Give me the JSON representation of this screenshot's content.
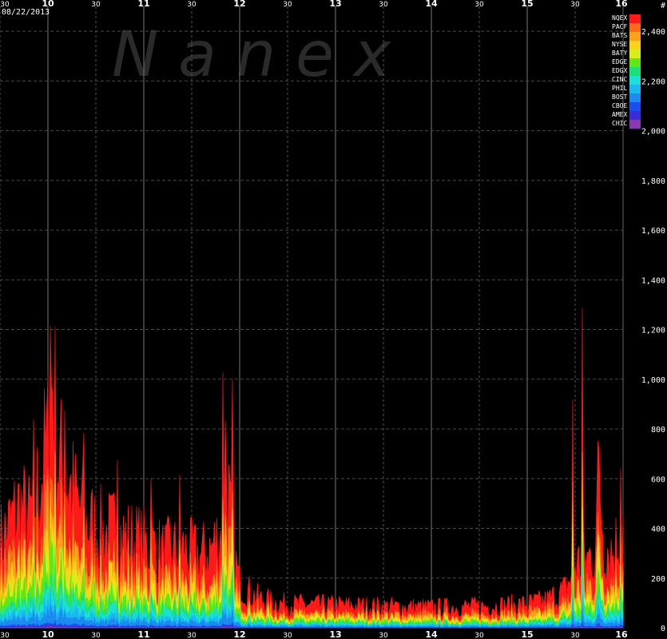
{
  "chart_data": {
    "type": "area",
    "date": "08/22/2013",
    "watermark": "N a n e x",
    "unit_label": "#",
    "x_range": [
      9.5,
      16.0
    ],
    "x_ticks": [
      {
        "value": 9.5,
        "label": "30",
        "major": false
      },
      {
        "value": 10,
        "label": "10",
        "major": true
      },
      {
        "value": 10.5,
        "label": "30",
        "major": false
      },
      {
        "value": 11,
        "label": "11",
        "major": true
      },
      {
        "value": 11.5,
        "label": "30",
        "major": false
      },
      {
        "value": 12,
        "label": "12",
        "major": true
      },
      {
        "value": 12.5,
        "label": "30",
        "major": false
      },
      {
        "value": 13,
        "label": "13",
        "major": true
      },
      {
        "value": 13.5,
        "label": "30",
        "major": false
      },
      {
        "value": 14,
        "label": "14",
        "major": true
      },
      {
        "value": 14.5,
        "label": "30",
        "major": false
      },
      {
        "value": 15,
        "label": "15",
        "major": true
      },
      {
        "value": 15.5,
        "label": "30",
        "major": false
      },
      {
        "value": 16,
        "label": "16",
        "major": true
      }
    ],
    "y_range": [
      0,
      2500
    ],
    "y_ticks": [
      {
        "value": 0,
        "label": "0"
      },
      {
        "value": 200,
        "label": "200"
      },
      {
        "value": 400,
        "label": "400"
      },
      {
        "value": 600,
        "label": "600"
      },
      {
        "value": 800,
        "label": "800"
      },
      {
        "value": 1000,
        "label": "1,000"
      },
      {
        "value": 1200,
        "label": "1,200"
      },
      {
        "value": 1400,
        "label": "1,400"
      },
      {
        "value": 1600,
        "label": "1,600"
      },
      {
        "value": 1800,
        "label": "1,800"
      },
      {
        "value": 2000,
        "label": "2,000"
      },
      {
        "value": 2200,
        "label": "2,200"
      },
      {
        "value": 2400,
        "label": "2,400"
      }
    ],
    "grid": true,
    "legend_position": "top-right",
    "series": [
      {
        "name": "NQEX",
        "color": "#ff1a1a"
      },
      {
        "name": "PACF",
        "color": "#ff6a1a"
      },
      {
        "name": "BATS",
        "color": "#ffa01a"
      },
      {
        "name": "NYSE",
        "color": "#ffd21a"
      },
      {
        "name": "BATY",
        "color": "#d8ee1a"
      },
      {
        "name": "EDGE",
        "color": "#5ee81a"
      },
      {
        "name": "EDGX",
        "color": "#1ae07a"
      },
      {
        "name": "CINC",
        "color": "#1ae0d8"
      },
      {
        "name": "PHIL",
        "color": "#1ab8f0"
      },
      {
        "name": "BOST",
        "color": "#1a8cf0"
      },
      {
        "name": "CBOE",
        "color": "#1a4ef0"
      },
      {
        "name": "AMEX",
        "color": "#3a2ad8"
      },
      {
        "name": "CHIC",
        "color": "#8a3ab0"
      }
    ],
    "total_profile": [
      [
        9.5,
        380
      ],
      [
        9.6,
        460
      ],
      [
        9.7,
        540
      ],
      [
        9.8,
        480
      ],
      [
        9.9,
        620
      ],
      [
        10.0,
        820
      ],
      [
        10.05,
        1150
      ],
      [
        10.1,
        760
      ],
      [
        10.2,
        650
      ],
      [
        10.3,
        560
      ],
      [
        10.4,
        470
      ],
      [
        10.5,
        440
      ],
      [
        10.6,
        420
      ],
      [
        10.7,
        430
      ],
      [
        10.8,
        400
      ],
      [
        10.9,
        390
      ],
      [
        11.0,
        370
      ],
      [
        11.1,
        360
      ],
      [
        11.2,
        330
      ],
      [
        11.3,
        340
      ],
      [
        11.4,
        350
      ],
      [
        11.5,
        330
      ],
      [
        11.6,
        320
      ],
      [
        11.7,
        350
      ],
      [
        11.8,
        420
      ],
      [
        11.85,
        800
      ],
      [
        11.9,
        500
      ],
      [
        11.95,
        300
      ],
      [
        12.0,
        200
      ],
      [
        12.1,
        160
      ],
      [
        12.2,
        130
      ],
      [
        12.3,
        120
      ],
      [
        12.4,
        110
      ],
      [
        12.5,
        105
      ],
      [
        13.0,
        100
      ],
      [
        13.5,
        95
      ],
      [
        14.0,
        90
      ],
      [
        14.5,
        95
      ],
      [
        15.0,
        105
      ],
      [
        15.2,
        120
      ],
      [
        15.4,
        170
      ],
      [
        15.5,
        280
      ],
      [
        15.6,
        300
      ],
      [
        15.7,
        330
      ],
      [
        15.75,
        700
      ],
      [
        15.8,
        380
      ],
      [
        15.9,
        340
      ],
      [
        16.0,
        450
      ]
    ],
    "spikes": [
      [
        10.02,
        1300
      ],
      [
        9.85,
        850
      ],
      [
        10.18,
        980
      ],
      [
        10.38,
        820
      ],
      [
        10.72,
        760
      ],
      [
        11.08,
        700
      ],
      [
        11.38,
        660
      ],
      [
        11.82,
        1150
      ],
      [
        11.92,
        1050
      ],
      [
        15.48,
        990
      ],
      [
        15.58,
        1380
      ],
      [
        15.98,
        700
      ]
    ],
    "layer_fractions": [
      0.42,
      0.08,
      0.08,
      0.08,
      0.05,
      0.08,
      0.05,
      0.05,
      0.04,
      0.05,
      0.01,
      0.005,
      0.005
    ]
  }
}
